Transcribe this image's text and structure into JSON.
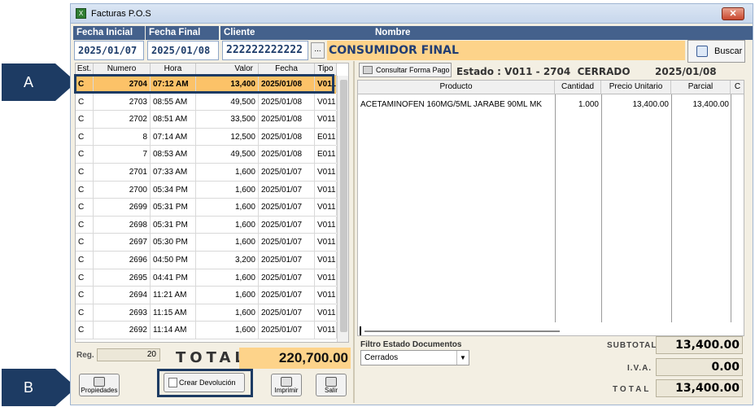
{
  "callouts": {
    "a": "A",
    "b": "B"
  },
  "window": {
    "title": "Facturas P.O.S",
    "close_icon": "close-icon"
  },
  "filters": {
    "fecha_inicial_label": "Fecha Inicial",
    "fecha_final_label": "Fecha Final",
    "cliente_label": "Cliente",
    "nombre_label": "Nombre",
    "fecha_inicial": "2025/01/07",
    "fecha_final": "2025/01/08",
    "cliente": "222222222222",
    "dots": "...",
    "nombre": "CONSUMIDOR FINAL",
    "buscar_label": "Buscar"
  },
  "list": {
    "headers": [
      "Est.",
      "Numero",
      "Hora",
      "Valor",
      "Fecha",
      "Tipo"
    ],
    "rows": [
      [
        "C",
        "2704",
        "07:12 AM",
        "13,400",
        "2025/01/08",
        "V011"
      ],
      [
        "C",
        "2703",
        "08:55 AM",
        "49,500",
        "2025/01/08",
        "V011"
      ],
      [
        "C",
        "2702",
        "08:51 AM",
        "33,500",
        "2025/01/08",
        "V011"
      ],
      [
        "C",
        "8",
        "07:14 AM",
        "12,500",
        "2025/01/08",
        "E011"
      ],
      [
        "C",
        "7",
        "08:53 AM",
        "49,500",
        "2025/01/08",
        "E011"
      ],
      [
        "C",
        "2701",
        "07:33 AM",
        "1,600",
        "2025/01/07",
        "V011"
      ],
      [
        "C",
        "2700",
        "05:34 PM",
        "1,600",
        "2025/01/07",
        "V011"
      ],
      [
        "C",
        "2699",
        "05:31 PM",
        "1,600",
        "2025/01/07",
        "V011"
      ],
      [
        "C",
        "2698",
        "05:31 PM",
        "1,600",
        "2025/01/07",
        "V011"
      ],
      [
        "C",
        "2697",
        "05:30 PM",
        "1,600",
        "2025/01/07",
        "V011"
      ],
      [
        "C",
        "2696",
        "04:50 PM",
        "3,200",
        "2025/01/07",
        "V011"
      ],
      [
        "C",
        "2695",
        "04:41 PM",
        "1,600",
        "2025/01/07",
        "V011"
      ],
      [
        "C",
        "2694",
        "11:21 AM",
        "1,600",
        "2025/01/07",
        "V011"
      ],
      [
        "C",
        "2693",
        "11:15 AM",
        "1,600",
        "2025/01/07",
        "V011"
      ],
      [
        "C",
        "2692",
        "11:14 AM",
        "1,600",
        "2025/01/07",
        "V011"
      ]
    ],
    "selected_index": 0,
    "reg_label": "Reg.",
    "reg_value": "20",
    "total_label": "TOTAL",
    "total_value": "220,700.00"
  },
  "buttons": {
    "propiedades": "Propiedades",
    "crear_devolucion": "Crear Devolución",
    "imprimir": "Imprimir",
    "salir": "Salir"
  },
  "detail": {
    "consultar_label": "Consultar Forma Pago",
    "estado_text": "Estado : V011 - 2704",
    "estado_status": "CERRADO",
    "estado_fecha": "2025/01/08",
    "headers": [
      "Producto",
      "Cantidad",
      "Precio Unitario",
      "Parcial",
      "C"
    ],
    "items": [
      {
        "producto": "ACETAMINOFEN 160MG/5ML JARABE 90ML MK",
        "cantidad": "1.000",
        "precio": "13,400.00",
        "parcial": "13,400.00"
      }
    ]
  },
  "filtro": {
    "label": "Filtro Estado Documentos",
    "selected": "Cerrados"
  },
  "summary": {
    "subtotal_label": "SUBTOTAL",
    "subtotal_value": "13,400.00",
    "iva_label": "I.V.A.",
    "iva_value": "0.00",
    "total_label": "TOTAL",
    "total_value": "13,400.00"
  },
  "colors": {
    "header_blue": "#44618c",
    "selection_orange": "#fcc268",
    "callout_navy": "#1d3b63",
    "total_bg": "#fdd38a"
  }
}
